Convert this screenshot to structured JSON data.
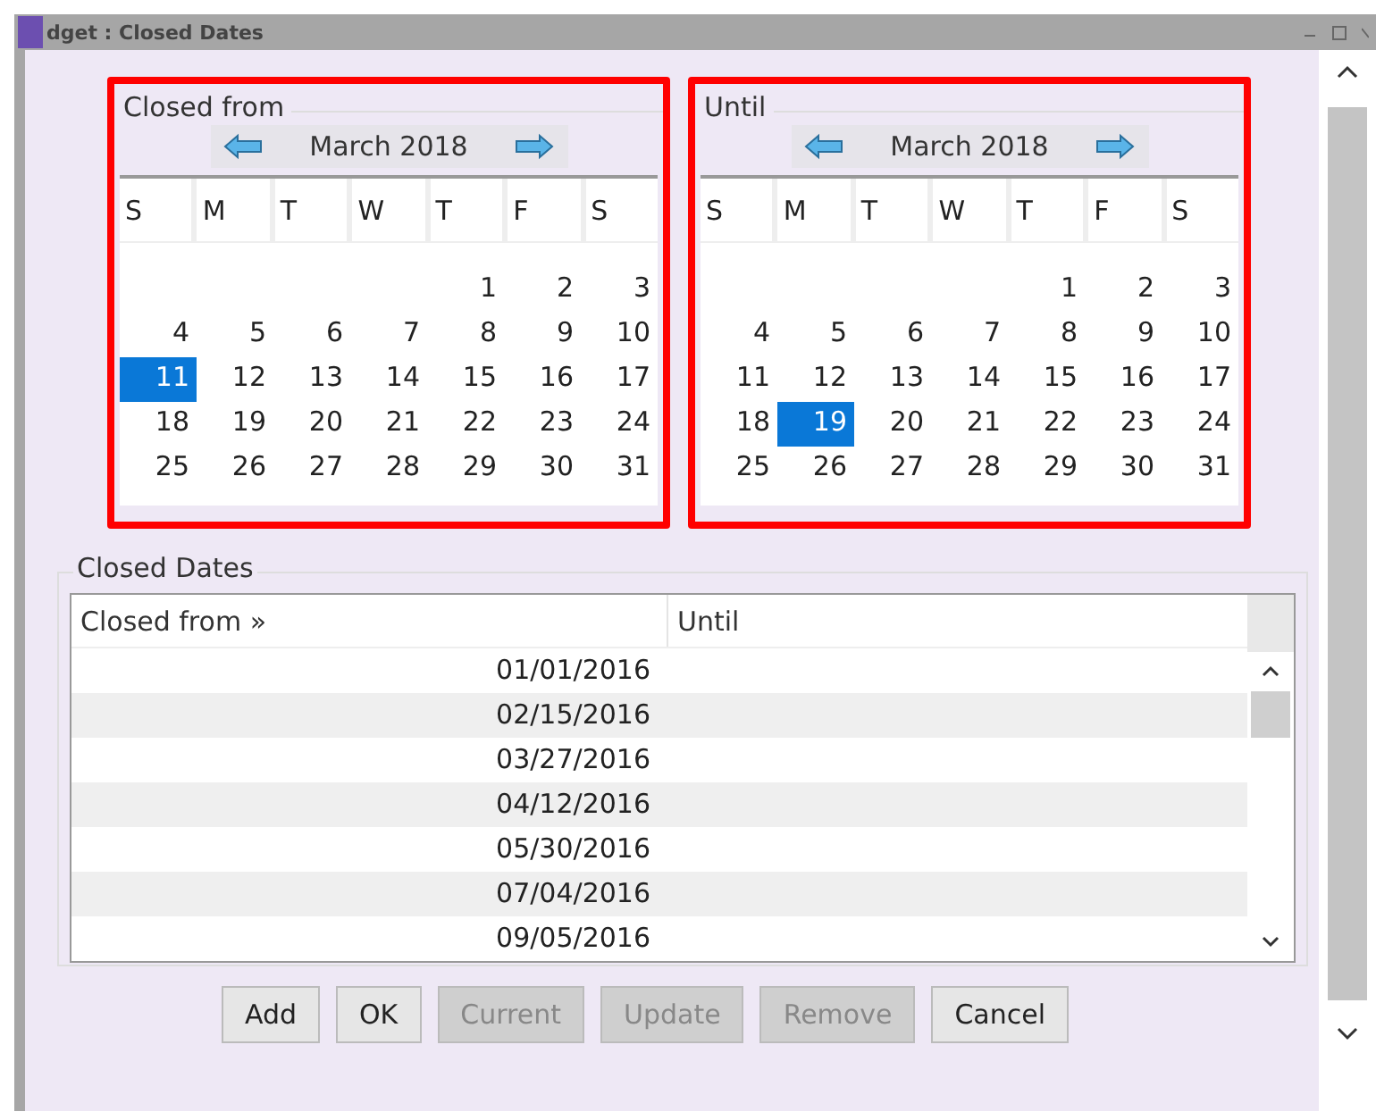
{
  "window": {
    "title": "dget : Closed Dates"
  },
  "calendars": [
    {
      "label": "Closed from",
      "month": "March 2018",
      "weekdays": [
        "S",
        "M",
        "T",
        "W",
        "T",
        "F",
        "S"
      ],
      "weeks": [
        [
          {
            "day": "1",
            "selected": false
          },
          {
            "day": "2",
            "selected": false
          },
          {
            "day": "3",
            "selected": false
          }
        ],
        [
          {
            "day": "4",
            "selected": false
          },
          {
            "day": "5",
            "selected": false
          },
          {
            "day": "6",
            "selected": false
          },
          {
            "day": "7",
            "selected": false
          },
          {
            "day": "8",
            "selected": false
          },
          {
            "day": "9",
            "selected": false
          },
          {
            "day": "10",
            "selected": false
          }
        ],
        [
          {
            "day": "11",
            "selected": true
          },
          {
            "day": "12",
            "selected": false
          },
          {
            "day": "13",
            "selected": false
          },
          {
            "day": "14",
            "selected": false
          },
          {
            "day": "15",
            "selected": false
          },
          {
            "day": "16",
            "selected": false
          },
          {
            "day": "17",
            "selected": false
          }
        ],
        [
          {
            "day": "18",
            "selected": false
          },
          {
            "day": "19",
            "selected": false
          },
          {
            "day": "20",
            "selected": false
          },
          {
            "day": "21",
            "selected": false
          },
          {
            "day": "22",
            "selected": false
          },
          {
            "day": "23",
            "selected": false
          },
          {
            "day": "24",
            "selected": false
          }
        ],
        [
          {
            "day": "25",
            "selected": false
          },
          {
            "day": "26",
            "selected": false
          },
          {
            "day": "27",
            "selected": false
          },
          {
            "day": "28",
            "selected": false
          },
          {
            "day": "29",
            "selected": false
          },
          {
            "day": "30",
            "selected": false
          },
          {
            "day": "31",
            "selected": false
          }
        ]
      ]
    },
    {
      "label": "Until",
      "month": "March 2018",
      "weekdays": [
        "S",
        "M",
        "T",
        "W",
        "T",
        "F",
        "S"
      ],
      "weeks": [
        [
          {
            "day": "1",
            "selected": false
          },
          {
            "day": "2",
            "selected": false
          },
          {
            "day": "3",
            "selected": false
          }
        ],
        [
          {
            "day": "4",
            "selected": false
          },
          {
            "day": "5",
            "selected": false
          },
          {
            "day": "6",
            "selected": false
          },
          {
            "day": "7",
            "selected": false
          },
          {
            "day": "8",
            "selected": false
          },
          {
            "day": "9",
            "selected": false
          },
          {
            "day": "10",
            "selected": false
          }
        ],
        [
          {
            "day": "11",
            "selected": false
          },
          {
            "day": "12",
            "selected": false
          },
          {
            "day": "13",
            "selected": false
          },
          {
            "day": "14",
            "selected": false
          },
          {
            "day": "15",
            "selected": false
          },
          {
            "day": "16",
            "selected": false
          },
          {
            "day": "17",
            "selected": false
          }
        ],
        [
          {
            "day": "18",
            "selected": false
          },
          {
            "day": "19",
            "selected": true
          },
          {
            "day": "20",
            "selected": false
          },
          {
            "day": "21",
            "selected": false
          },
          {
            "day": "22",
            "selected": false
          },
          {
            "day": "23",
            "selected": false
          },
          {
            "day": "24",
            "selected": false
          }
        ],
        [
          {
            "day": "25",
            "selected": false
          },
          {
            "day": "26",
            "selected": false
          },
          {
            "day": "27",
            "selected": false
          },
          {
            "day": "28",
            "selected": false
          },
          {
            "day": "29",
            "selected": false
          },
          {
            "day": "30",
            "selected": false
          },
          {
            "day": "31",
            "selected": false
          }
        ]
      ]
    }
  ],
  "closed_dates": {
    "label": "Closed Dates",
    "columns": [
      "Closed from »",
      "Until"
    ],
    "rows": [
      {
        "closed_from": "01/01/2016"
      },
      {
        "closed_from": "02/15/2016"
      },
      {
        "closed_from": "03/27/2016"
      },
      {
        "closed_from": "04/12/2016"
      },
      {
        "closed_from": "05/30/2016"
      },
      {
        "closed_from": "07/04/2016"
      },
      {
        "closed_from": "09/05/2016"
      }
    ]
  },
  "buttons": [
    {
      "label": "Add",
      "disabled": false
    },
    {
      "label": "OK",
      "disabled": false
    },
    {
      "label": "Current",
      "disabled": true
    },
    {
      "label": "Update",
      "disabled": true
    },
    {
      "label": "Remove",
      "disabled": true
    },
    {
      "label": "Cancel",
      "disabled": false
    }
  ]
}
